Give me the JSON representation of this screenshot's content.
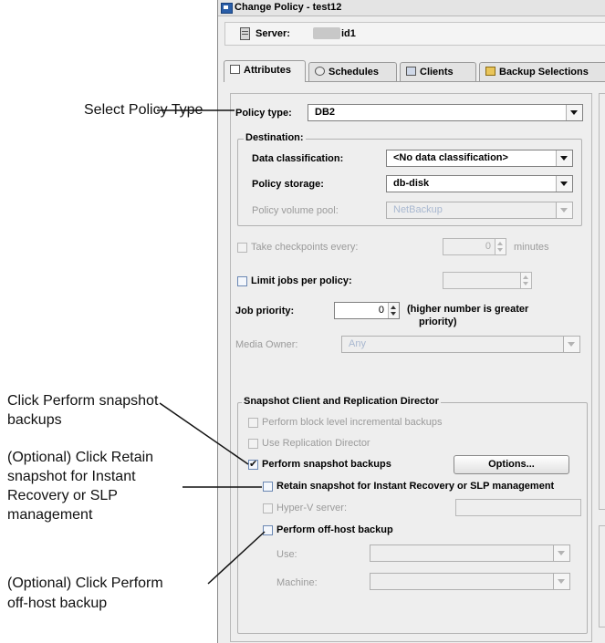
{
  "callouts": {
    "select_policy_type": "Select Policy Type",
    "perform_snapshot_1": "Click Perform snapshot",
    "perform_snapshot_2": "backups",
    "retain_1": "(Optional) Click Retain",
    "retain_2": "snapshot for Instant",
    "retain_3": "Recovery or SLP",
    "retain_4": "management",
    "offhost_1": "(Optional) Click Perform",
    "offhost_2": "off-host backup"
  },
  "window": {
    "title": "Change Policy - test12",
    "server_label": "Server:",
    "server_value": "id1"
  },
  "tabs": [
    {
      "label": "Attributes",
      "icon": "attributes-icon"
    },
    {
      "label": "Schedules",
      "icon": "schedules-icon"
    },
    {
      "label": "Clients",
      "icon": "clients-icon"
    },
    {
      "label": "Backup Selections",
      "icon": "backup-selections-icon"
    }
  ],
  "policy_type": {
    "label": "Policy type:",
    "value": "DB2"
  },
  "destination": {
    "title": "Destination:",
    "data_classification_label": "Data classification:",
    "data_classification_value": "<No data classification>",
    "policy_storage_label": "Policy storage:",
    "policy_storage_value": "db-disk",
    "volume_pool_label": "Policy volume pool:",
    "volume_pool_value": "NetBackup"
  },
  "checkpoints": {
    "label": "Take checkpoints every:",
    "value": "0",
    "unit": "minutes"
  },
  "limit_jobs": {
    "label": "Limit jobs per policy:"
  },
  "job_priority": {
    "label": "Job priority:",
    "value": "0",
    "note_1": "(higher number is greater",
    "note_2": "priority)"
  },
  "media_owner": {
    "label": "Media Owner:",
    "value": "Any"
  },
  "snapshot": {
    "title": "Snapshot Client and Replication Director",
    "block_level": "Perform block level incremental backups",
    "replication_director": "Use Replication Director",
    "perform_snapshot": "Perform snapshot backups",
    "options_button": "Options...",
    "retain": "Retain snapshot for Instant Recovery or SLP management",
    "hyperv": "Hyper-V server:",
    "offhost": "Perform off-host backup",
    "use_label": "Use:",
    "machine_label": "Machine:"
  },
  "colors": {
    "window_bg": "#eeeeee",
    "disabled_text": "#9b9b9b",
    "leader_line": "#111111"
  }
}
